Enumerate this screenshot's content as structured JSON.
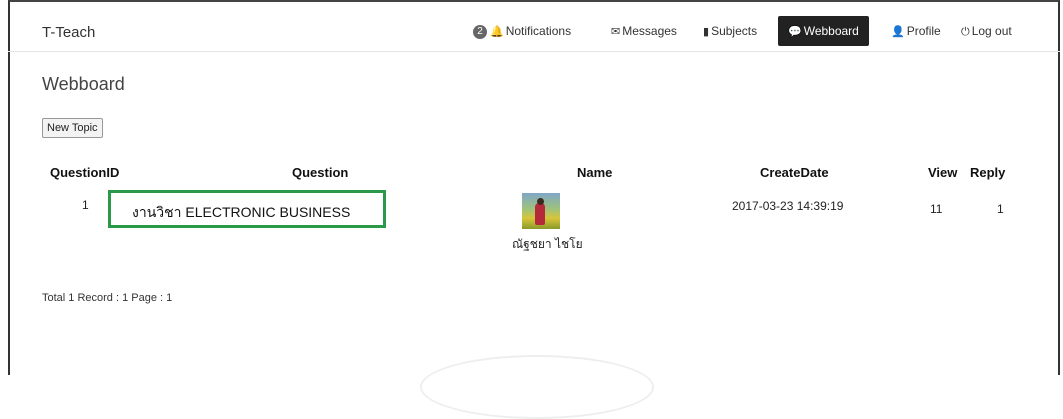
{
  "brand": "T-Teach",
  "nav": {
    "notifications": {
      "badge": "2",
      "label": "Notifications"
    },
    "messages": "Messages",
    "subjects": "Subjects",
    "webboard": "Webboard",
    "profile": "Profile",
    "logout": "Log out"
  },
  "page_title": "Webboard",
  "new_topic_button": "New Topic",
  "table": {
    "headers": {
      "id": "QuestionID",
      "question": "Question",
      "name": "Name",
      "create_date": "CreateDate",
      "view": "View",
      "reply": "Reply"
    },
    "rows": [
      {
        "id": "1",
        "question": "งานวิชา ELECTRONIC BUSINESS",
        "name": "ณัฐชยา ไชโย",
        "create_date": "2017-03-23 14:39:19",
        "view": "11",
        "reply": "1"
      }
    ]
  },
  "footer": "Total 1 Record : 1 Page : 1",
  "colors": {
    "active_nav_bg": "#222222",
    "highlight_border": "#2a9a4a"
  },
  "icons": {
    "notifications": "bell-icon",
    "messages": "envelope-icon",
    "subjects": "book-icon",
    "webboard": "comment-icon",
    "profile": "user-icon",
    "logout": "power-icon"
  }
}
